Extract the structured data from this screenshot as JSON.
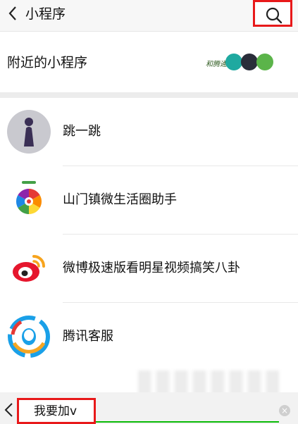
{
  "header": {
    "title": "小程序",
    "back_icon": "chevron-left-icon",
    "search_icon": "search-icon",
    "highlight_color": "#e8191a"
  },
  "nearby": {
    "label": "附近的小程序",
    "logo_text": "和腾通"
  },
  "apps": [
    {
      "name": "跳一跳",
      "icon": "jump-game-icon"
    },
    {
      "name": "山门镇微生活圈助手",
      "icon": "color-wheel-icon"
    },
    {
      "name": "微博极速版看明星视频搞笑八卦",
      "icon": "weibo-icon"
    },
    {
      "name": "腾讯客服",
      "icon": "tencent-service-icon"
    }
  ],
  "search_bar": {
    "value": "我要加v",
    "accent_color": "#09bb07",
    "clear_label": "×"
  }
}
